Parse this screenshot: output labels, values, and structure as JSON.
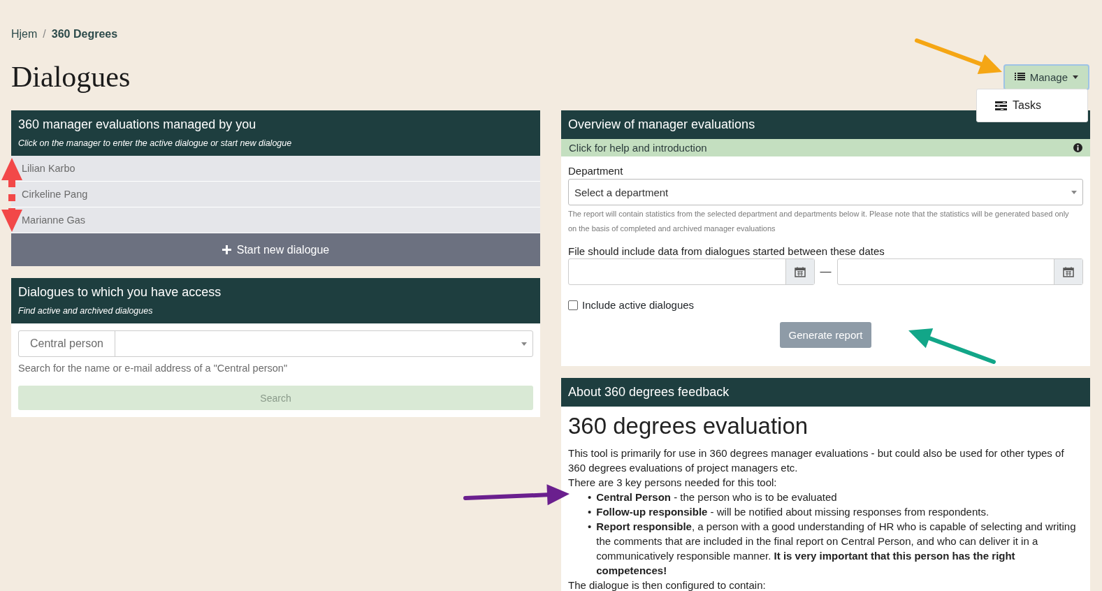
{
  "breadcrumb": [
    {
      "label": "Hjem",
      "current": false
    },
    {
      "separator": "/",
      "label": "360 Degrees",
      "current": true
    }
  ],
  "page_title": "Dialogues",
  "manage_menu": {
    "label": "Manage",
    "expanded": true,
    "items": [
      "Tasks"
    ]
  },
  "managed_card": {
    "title": "360 manager evaluations managed by you",
    "subtitle": "Click on the manager to enter the active dialogue or start new dialogue",
    "managers": [
      "Lilian Karbo",
      "Cirkeline Pang",
      "Marianne Gas"
    ],
    "button": "Start new dialogue"
  },
  "access_card": {
    "title": "Dialogues to which you have access",
    "subtitle": "Find active and archived dialogues",
    "field_label": "Central person",
    "help": "Search for the name or e-mail address of a \"Central person\"",
    "button": "Search"
  },
  "overview_card": {
    "title": "Overview of manager evaluations",
    "help_bar": "Click for help and introduction",
    "department_label": "Department",
    "department_placeholder": "Select a department",
    "department_note": "The report will contain statistics from the selected department and departments below it. Please note that the statistics will be generated based only on the basis of completed and archived manager evaluations",
    "dates_label": "File should include data from dialogues started between these dates",
    "dates_separator": "—",
    "include_active": {
      "label": "Include active dialogues",
      "checked": false
    },
    "button": "Generate report"
  },
  "about_card": {
    "title": "About 360 degrees feedback",
    "heading": "360 degrees evaluation",
    "intro": "This tool is primarily for use in 360 degrees manager evaluations - but could also be used for other types of 360 degrees evaluations of project managers etc.",
    "persons_intro": "There are 3 key persons needed for this tool:",
    "persons": [
      {
        "bullet": "•",
        "text": "**Central Person** - the person who is to be evaluated"
      },
      {
        "bullet": "•",
        "text": "**Follow-up responsible** - will be notified about missing responses from respondents."
      },
      {
        "bullet": "•",
        "text": "**Report responsible**, a person with a good understanding of HR who is capable of selecting and writing the comments that are included in the final report on Central Person, and who can deliver it in a communicatively responsible manner. **It is very important that this person has the right competences!**"
      }
    ],
    "config_intro": "The dialogue is then configured to contain:"
  },
  "annotation_arrows": [
    {
      "kind": "single",
      "color": "#f5a614"
    },
    {
      "kind": "single",
      "color": "#12a688"
    },
    {
      "kind": "single",
      "color": "#6a1f8e"
    },
    {
      "kind": "double",
      "color": "#f24848"
    }
  ]
}
